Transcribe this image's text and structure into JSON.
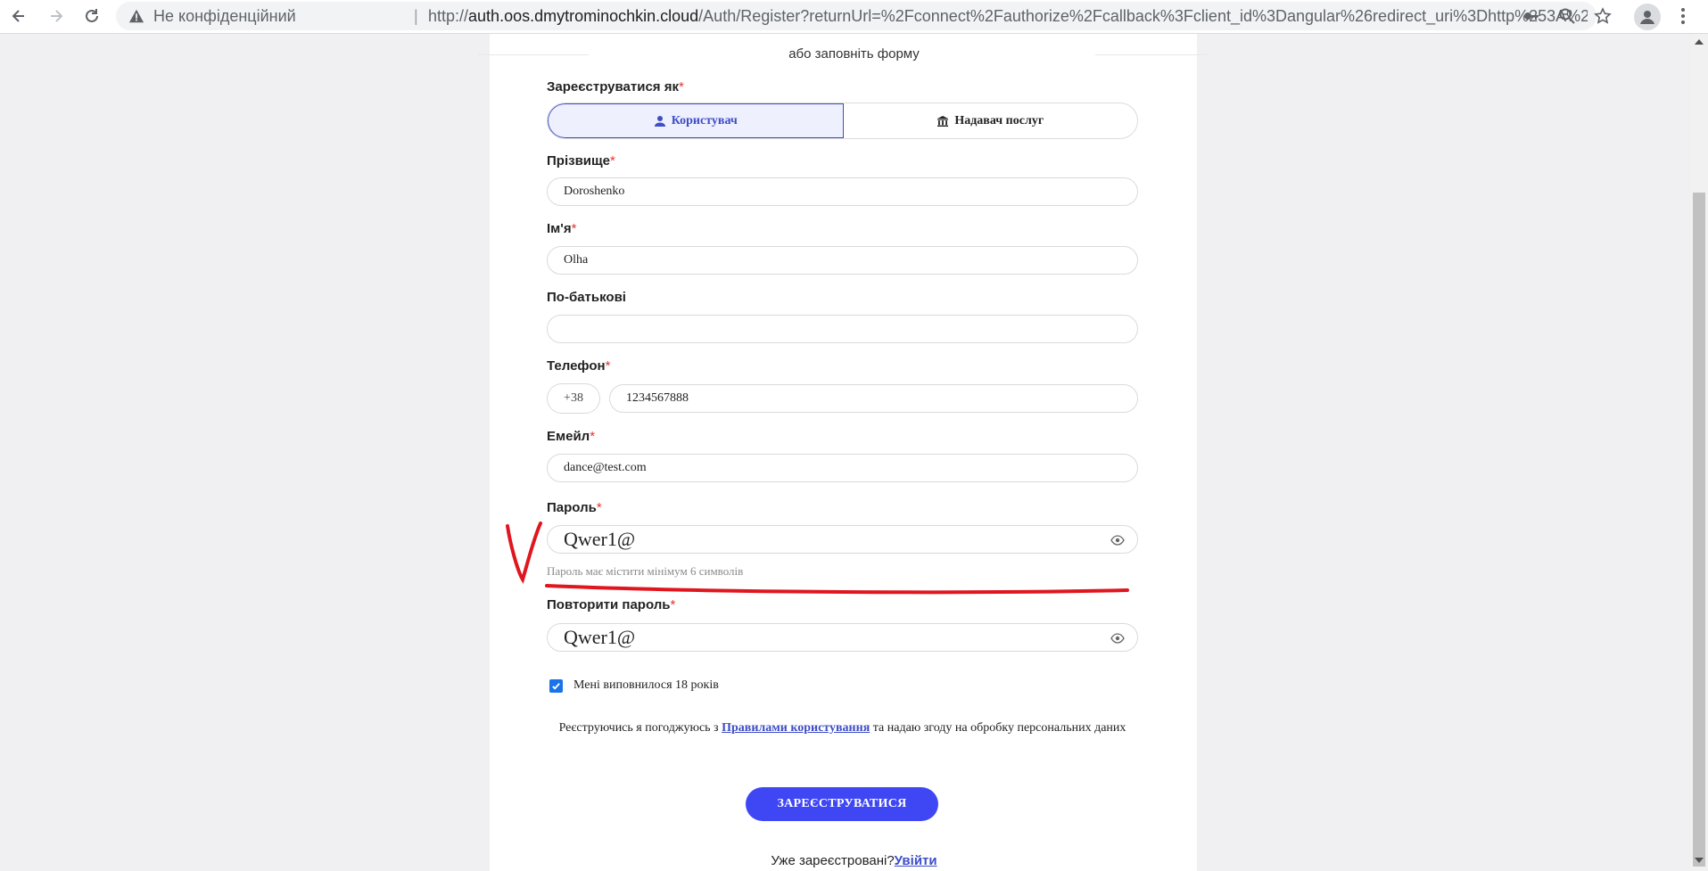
{
  "browser": {
    "insecure_label": "Не конфіденційний",
    "separator": "|",
    "url_scheme": "http://",
    "url_host": "auth.oos.dmytrominochkin.cloud",
    "url_path": "/Auth/Register?returnUrl=%2Fconnect%2Fauthorize%2Fcallback%3Fclient_id%3Dangular%26redirect_uri%3Dhttp%253A%252F%252..."
  },
  "form": {
    "or_text": "або заповніть форму",
    "register_as_label": "Зареєструватися як",
    "required_mark": "*",
    "roles": {
      "user": "Користувач",
      "provider": "Надавач послуг"
    },
    "last_name_label": "Прізвище",
    "last_name_value": "Doroshenko",
    "first_name_label": "Ім'я",
    "first_name_value": "Olha",
    "middle_name_label": "По-батькові",
    "middle_name_value": "",
    "phone_label": "Телефон",
    "phone_prefix": "+38",
    "phone_value": "1234567888",
    "email_label": "Емейл",
    "email_value": "dance@test.com",
    "password_label": "Пароль",
    "password_value": "Qwer1@",
    "password_hint": "Пароль має містити мінімум 6 символів",
    "repeat_password_label": "Повторити пароль",
    "repeat_password_value": "Qwer1@",
    "age_checkbox_label": "Мені виповнилося 18 років",
    "age_checked": true,
    "terms_prefix": "Реєструючись я погоджуюсь з ",
    "terms_link": "Правилами користування",
    "terms_suffix": " та надаю згоду на обробку персональних даних",
    "submit_label": "ЗАРЕЄСТРУВАТИСЯ",
    "already_registered": "Уже зареєстровані?",
    "login_link": "Увійти"
  },
  "colors": {
    "accent": "#3d4dc7",
    "submit": "#3f47f5",
    "required": "#e5352f",
    "annotation": "#e0161f"
  },
  "icons": [
    "back-arrow-icon",
    "forward-arrow-icon",
    "reload-icon",
    "warning-icon",
    "key-icon",
    "zoom-icon",
    "star-icon",
    "profile-icon",
    "menu-dots-icon",
    "user-icon",
    "bank-icon",
    "eye-icon",
    "check-icon"
  ]
}
